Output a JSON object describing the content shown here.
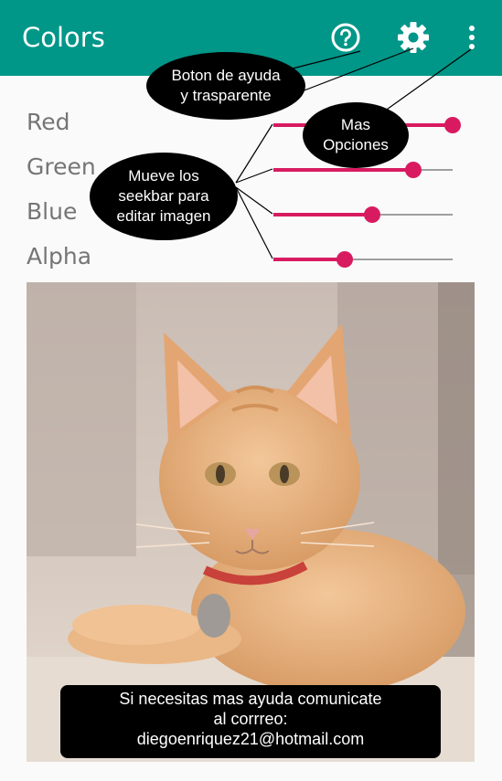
{
  "app": {
    "title": "Colors"
  },
  "toolbar": {
    "help_icon": "help-circle-icon",
    "settings_icon": "gear-icon",
    "more_icon": "more-vert-icon"
  },
  "sliders": [
    {
      "label": "Red",
      "value": 1.0
    },
    {
      "label": "Green",
      "value": 0.78
    },
    {
      "label": "Blue",
      "value": 0.55
    },
    {
      "label": "Alpha",
      "value": 0.4
    }
  ],
  "annotations": {
    "help_bubble": "Boton de ayuda\ny trasparente",
    "more_bubble": "Mas\nOpciones",
    "seekbar_bubble": "Mueve los\nseekbar para\neditar imagen"
  },
  "footer_note": {
    "line1": "Si necesitas mas ayuda comunicate",
    "line2": "al corrreo:",
    "line3": "diegoenriquez21@hotmail.com"
  },
  "colors": {
    "appbar": "#009688",
    "accent": "#d81b60"
  }
}
